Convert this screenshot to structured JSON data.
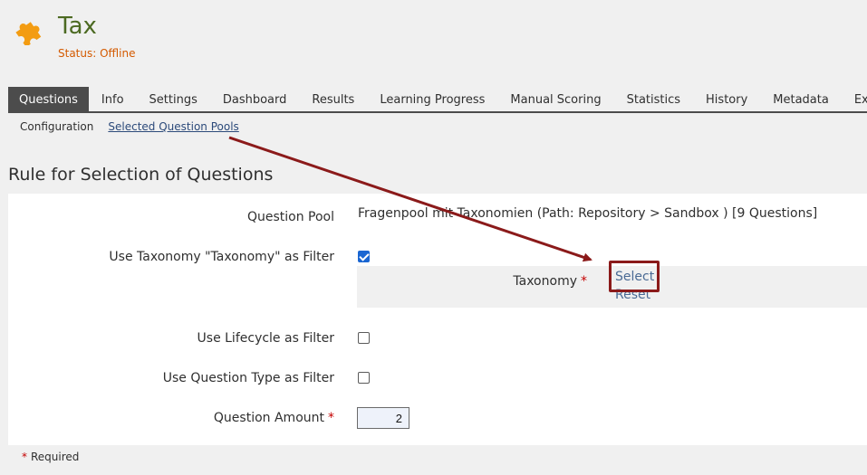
{
  "object": {
    "title": "Tax",
    "status": "Status: Offline",
    "icon": "puzzle-icon",
    "icon_color": "#f39c12"
  },
  "tabs": [
    {
      "label": "Questions",
      "active": true
    },
    {
      "label": "Info"
    },
    {
      "label": "Settings"
    },
    {
      "label": "Dashboard"
    },
    {
      "label": "Results"
    },
    {
      "label": "Learning Progress"
    },
    {
      "label": "Manual Scoring"
    },
    {
      "label": "Statistics"
    },
    {
      "label": "History"
    },
    {
      "label": "Metadata"
    },
    {
      "label": "Export"
    }
  ],
  "subtabs": [
    {
      "label": "Configuration"
    },
    {
      "label": "Selected Question Pools",
      "active": true
    }
  ],
  "section_title": "Rule for Selection of Questions",
  "form": {
    "question_pool_label": "Question Pool",
    "question_pool_value": "Fragenpool mit Taxonomien (Path: Repository > Sandbox ) [9 Questions]",
    "taxonomy_filter_label": "Use Taxonomy \"Taxonomy\" as Filter",
    "taxonomy_filter_checked": true,
    "taxonomy_label": "Taxonomy",
    "taxonomy_select": "Select",
    "taxonomy_reset": "Reset",
    "lifecycle_label": "Use Lifecycle as Filter",
    "lifecycle_checked": false,
    "question_type_label": "Use Question Type as Filter",
    "question_type_checked": false,
    "amount_label": "Question Amount",
    "amount_value": "2",
    "required_marker": "*"
  },
  "required_note": "Required",
  "annotation": {
    "color": "#8b1a1a"
  }
}
